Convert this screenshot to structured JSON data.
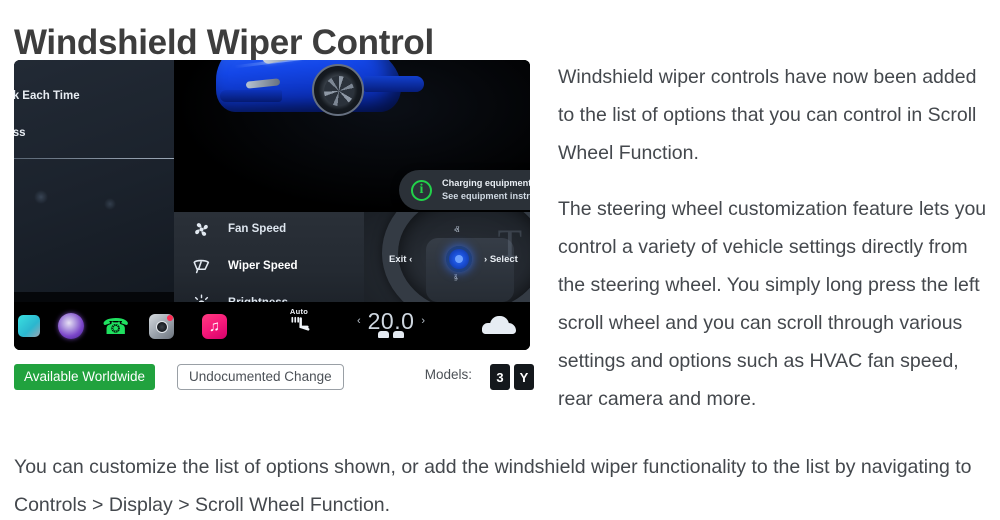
{
  "page_title": "Windshield Wiper Control",
  "screenshot": {
    "settings_panel": {
      "option_1": "Ask Each Time",
      "option_2": "cess"
    },
    "toast": {
      "icon": "info-circle-icon",
      "line1": "Charging equipment not ready",
      "line2": "See equipment instructions to start charging"
    },
    "scroll_wheel_menu": {
      "items": [
        {
          "icon": "fan-icon",
          "label": "Fan Speed"
        },
        {
          "icon": "wiper-icon",
          "label": "Wiper Speed"
        },
        {
          "icon": "brightness-icon",
          "label": "Brightness"
        }
      ],
      "exit_hint": "Exit",
      "exit_chevron": "‹",
      "select_chevron": "›",
      "select_hint": "Select",
      "chevron_up": "ⱏ",
      "chevron_down": "ⱛ"
    },
    "taskbar": {
      "icons": [
        "app-cyan-icon",
        "siri-icon",
        "phone-icon",
        "camera-icon",
        "music-icon"
      ],
      "seat_heater": {
        "label": "Auto",
        "glyph": "💺"
      },
      "climate": {
        "decrease": "‹",
        "temperature": "20.0",
        "increase": "›"
      },
      "car_icon": "car-icon"
    }
  },
  "badges": {
    "availability": "Available Worldwide",
    "change_type": "Undocumented Change",
    "models_label": "Models:",
    "models": [
      "3",
      "Y"
    ],
    "green": "#21a23e"
  },
  "body": {
    "paragraph_1": "Windshield wiper controls have now been added to the list of options that you can control in Scroll Wheel Function.",
    "paragraph_2": "The steering wheel customization feature lets you control a variety of vehicle settings directly from the steering wheel. You simply long press the left scroll wheel and you can scroll through various settings and options such as HVAC fan speed, rear camera and more.",
    "paragraph_3": "You can customize the list of options shown, or add the windshield wiper functionality to the list by navigating to Controls > Display > Scroll Wheel Function."
  }
}
